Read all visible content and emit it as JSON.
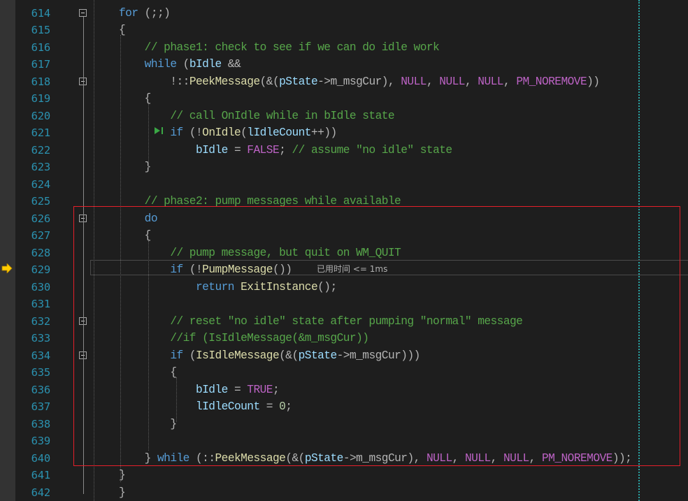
{
  "editor": {
    "colors": {
      "background": "#1e1e1e",
      "line_number": "#2b91af",
      "keyword": "#569cd6",
      "comment": "#57a64a",
      "function": "#dcdcaa",
      "macro": "#bd63c5",
      "variable": "#9cdcfe",
      "highlight_box": "#e51f2a"
    },
    "current_line": 629,
    "perf_tip": "已用时间 <= 1ms",
    "lines": [
      {
        "n": "614",
        "code": [
          [
            "kw",
            "for"
          ],
          [
            "op",
            " (;;)"
          ]
        ]
      },
      {
        "n": "615",
        "code": [
          [
            "op",
            "{"
          ]
        ]
      },
      {
        "n": "616",
        "code": [
          [
            "cm",
            "    // phase1: check to see if we can do idle work"
          ]
        ]
      },
      {
        "n": "617",
        "code": [
          [
            "kw",
            "    while"
          ],
          [
            "op",
            " ("
          ],
          [
            "var",
            "bIdle"
          ],
          [
            "op",
            " &&"
          ]
        ]
      },
      {
        "n": "618",
        "code": [
          [
            "op",
            "        !::"
          ],
          [
            "fn",
            "PeekMessage"
          ],
          [
            "op",
            "(&("
          ],
          [
            "var",
            "pState"
          ],
          [
            "op",
            "->m_msgCur), "
          ],
          [
            "mc",
            "NULL"
          ],
          [
            "op",
            ", "
          ],
          [
            "mc",
            "NULL"
          ],
          [
            "op",
            ", "
          ],
          [
            "mc",
            "NULL"
          ],
          [
            "op",
            ", "
          ],
          [
            "mc",
            "PM_NOREMOVE"
          ],
          [
            "op",
            "))"
          ]
        ]
      },
      {
        "n": "619",
        "code": [
          [
            "op",
            "    {"
          ]
        ]
      },
      {
        "n": "620",
        "code": [
          [
            "cm",
            "        // call OnIdle while in bIdle state"
          ]
        ]
      },
      {
        "n": "621",
        "code": [
          [
            "kw",
            "        if"
          ],
          [
            "op",
            " (!"
          ],
          [
            "fn",
            "OnIdle"
          ],
          [
            "op",
            "("
          ],
          [
            "var",
            "lIdleCount"
          ],
          [
            "op",
            "++))"
          ]
        ]
      },
      {
        "n": "622",
        "code": [
          [
            "var",
            "            bIdle"
          ],
          [
            "op",
            " = "
          ],
          [
            "mc",
            "FALSE"
          ],
          [
            "op",
            "; "
          ],
          [
            "cm",
            "// assume \"no idle\" state"
          ]
        ]
      },
      {
        "n": "623",
        "code": [
          [
            "op",
            "    }"
          ]
        ]
      },
      {
        "n": "624",
        "code": []
      },
      {
        "n": "625",
        "code": [
          [
            "cm",
            "    // phase2: pump messages while available"
          ]
        ]
      },
      {
        "n": "626",
        "code": [
          [
            "kw",
            "    do"
          ]
        ]
      },
      {
        "n": "627",
        "code": [
          [
            "op",
            "    {"
          ]
        ]
      },
      {
        "n": "628",
        "code": [
          [
            "cm",
            "        // pump message, but quit on WM_QUIT"
          ]
        ]
      },
      {
        "n": "629",
        "code": [
          [
            "kw",
            "        if"
          ],
          [
            "op",
            " (!"
          ],
          [
            "fn",
            "PumpMessage"
          ],
          [
            "op",
            "())"
          ]
        ]
      },
      {
        "n": "630",
        "code": [
          [
            "kw",
            "            return"
          ],
          [
            "op",
            " "
          ],
          [
            "fn",
            "ExitInstance"
          ],
          [
            "op",
            "();"
          ]
        ]
      },
      {
        "n": "631",
        "code": []
      },
      {
        "n": "632",
        "code": [
          [
            "cm",
            "        // reset \"no idle\" state after pumping \"normal\" message"
          ]
        ]
      },
      {
        "n": "633",
        "code": [
          [
            "cm",
            "        //if (IsIdleMessage(&m_msgCur))"
          ]
        ]
      },
      {
        "n": "634",
        "code": [
          [
            "kw",
            "        if"
          ],
          [
            "op",
            " ("
          ],
          [
            "fn",
            "IsIdleMessage"
          ],
          [
            "op",
            "(&("
          ],
          [
            "var",
            "pState"
          ],
          [
            "op",
            "->m_msgCur)))"
          ]
        ]
      },
      {
        "n": "635",
        "code": [
          [
            "op",
            "        {"
          ]
        ]
      },
      {
        "n": "636",
        "code": [
          [
            "var",
            "            bIdle"
          ],
          [
            "op",
            " = "
          ],
          [
            "mc",
            "TRUE"
          ],
          [
            "op",
            ";"
          ]
        ]
      },
      {
        "n": "637",
        "code": [
          [
            "var",
            "            lIdleCount"
          ],
          [
            "op",
            " = "
          ],
          [
            "num",
            "0"
          ],
          [
            "op",
            ";"
          ]
        ]
      },
      {
        "n": "638",
        "code": [
          [
            "op",
            "        }"
          ]
        ]
      },
      {
        "n": "639",
        "code": []
      },
      {
        "n": "640",
        "code": [
          [
            "op",
            "    } "
          ],
          [
            "kw",
            "while"
          ],
          [
            "op",
            " (::"
          ],
          [
            "fn",
            "PeekMessage"
          ],
          [
            "op",
            "(&("
          ],
          [
            "var",
            "pState"
          ],
          [
            "op",
            "->m_msgCur), "
          ],
          [
            "mc",
            "NULL"
          ],
          [
            "op",
            ", "
          ],
          [
            "mc",
            "NULL"
          ],
          [
            "op",
            ", "
          ],
          [
            "mc",
            "NULL"
          ],
          [
            "op",
            ", "
          ],
          [
            "mc",
            "PM_NOREMOVE"
          ],
          [
            "op",
            "));"
          ]
        ]
      },
      {
        "n": "641",
        "code": [
          [
            "op",
            "}"
          ]
        ]
      },
      {
        "n": "642",
        "code": [
          [
            "op",
            "}"
          ]
        ]
      }
    ]
  }
}
